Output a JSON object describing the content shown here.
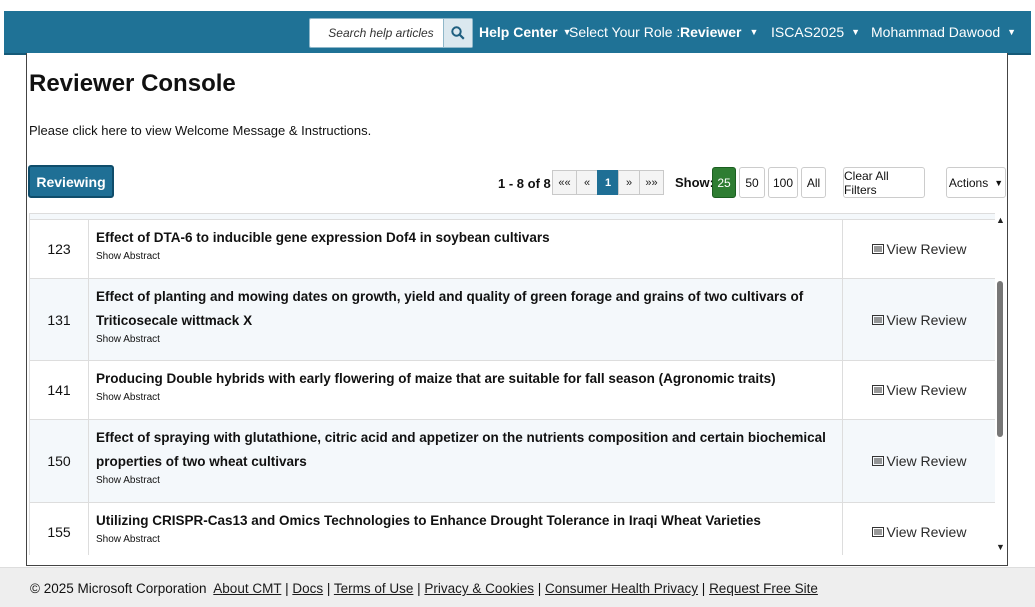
{
  "header": {
    "search_placeholder": "Search help articles",
    "help_center": "Help Center",
    "role_label": "Select Your Role :",
    "role_value": "Reviewer",
    "conference": "ISCAS2025",
    "user_name": "Mohammad Dawood"
  },
  "page": {
    "title": "Reviewer Console",
    "welcome": "Please click here to view Welcome Message & Instructions.",
    "reviewing_tab": "Reviewing"
  },
  "pager": {
    "range": "1 - 8 of 8",
    "first": "««",
    "prev": "«",
    "current": "1",
    "next": "»",
    "last": "»»"
  },
  "show": {
    "label": "Show:",
    "options": [
      "25",
      "50",
      "100",
      "All"
    ],
    "selected": "25"
  },
  "toolbar": {
    "clear_filters": "Clear All Filters",
    "actions": "Actions"
  },
  "rows": [
    {
      "id": "123",
      "title": "Effect of DTA-6 to inducible gene expression Dof4 in soybean cultivars",
      "abstract": "Show Abstract",
      "action": "View Review"
    },
    {
      "id": "131",
      "title": "Effect of planting and mowing dates on growth, yield and quality of green forage and grains of two cultivars of Triticosecale wittmack X",
      "abstract": "Show Abstract",
      "action": "View Review"
    },
    {
      "id": "141",
      "title": "Producing Double hybrids with early flowering of maize that are suitable for fall season (Agronomic traits)",
      "abstract": "Show Abstract",
      "action": "View Review"
    },
    {
      "id": "150",
      "title": "Effect of spraying with glutathione, citric acid and appetizer on the nutrients composition and certain biochemical properties of two wheat cultivars",
      "abstract": "Show Abstract",
      "action": "View Review"
    },
    {
      "id": "155",
      "title": "Utilizing CRISPR-Cas13 and Omics Technologies to Enhance Drought Tolerance in Iraqi Wheat Varieties",
      "abstract": "Show Abstract",
      "action": "View Review"
    }
  ],
  "footer": {
    "copyright": "© 2025 Microsoft Corporation",
    "links": [
      "About CMT",
      "Docs",
      "Terms of Use",
      "Privacy & Cookies",
      "Consumer Health Privacy",
      "Request Free Site"
    ]
  },
  "icons": {
    "search": "search-icon",
    "view": "list-icon",
    "caret": "caret-down-icon"
  },
  "colors": {
    "header_bg": "#1f7296",
    "primary_button": "#1f6f95",
    "show_selected": "#2e7d32"
  }
}
